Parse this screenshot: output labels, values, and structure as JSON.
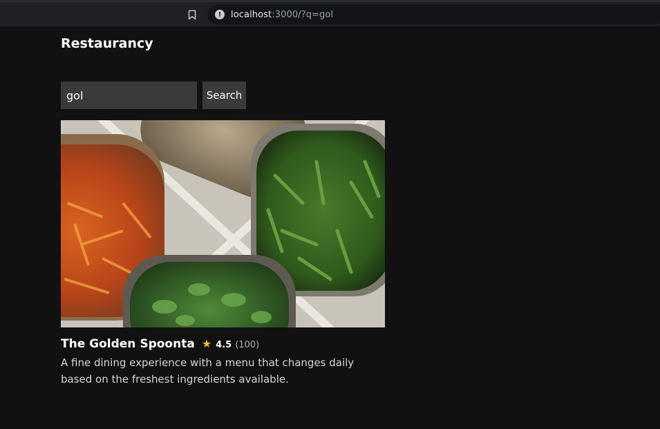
{
  "browser": {
    "url_host": "localhost",
    "url_rest": ":3000/?q=gol",
    "bookmark_icon": "bookmark-icon",
    "info_icon": "info-icon"
  },
  "app": {
    "brand": "Restaurancy"
  },
  "search": {
    "value": "gol",
    "button_label": "Search"
  },
  "results": [
    {
      "name": "The Golden Spoonta",
      "star": "★",
      "rating": "4.5",
      "reviews": "(100)",
      "description": "A fine dining experience with a menu that changes daily based on the freshest ingredients available.",
      "image_icon": "food-trays-image"
    }
  ],
  "colors": {
    "background": "#111111",
    "star": "#f5b83d",
    "input_bg": "#3a3a3a"
  }
}
